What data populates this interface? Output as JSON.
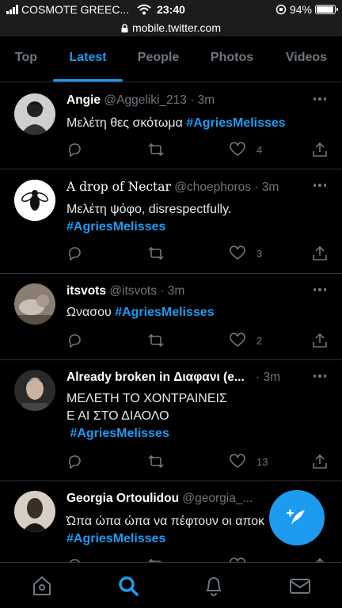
{
  "status_bar": {
    "carrier": "COSMOTE GREEC...",
    "time": "23:40",
    "battery": "94%",
    "battery_level": 0.94
  },
  "url_bar": {
    "url": "mobile.twitter.com"
  },
  "tabs": [
    {
      "label": "Top",
      "active": false
    },
    {
      "label": "Latest",
      "active": true
    },
    {
      "label": "People",
      "active": false
    },
    {
      "label": "Photos",
      "active": false
    },
    {
      "label": "Videos",
      "active": false
    }
  ],
  "tweets": [
    {
      "name": "Angie",
      "handle": "@Aggeliki_213",
      "time": "· 3m",
      "text_plain": "Μελέτη θες σκότωμα ",
      "hashtag": "#AgriesMelisses",
      "likes": "4"
    },
    {
      "name": "A drop of Nectar",
      "handle": "@choephoros",
      "time": "· 3m",
      "text_plain": "Μελέτη ψόφο, disrespectfully.",
      "hashtag": "#AgriesMelisses",
      "likes": "3"
    },
    {
      "name": "itsvots",
      "handle": "@itsvots",
      "time": "· 3m",
      "text_plain": "Ωνασου ",
      "hashtag": "#AgriesMelisses",
      "likes": "2"
    },
    {
      "name": "Already broken in Διαφανι (e...",
      "handle": "",
      "time": "· 3m",
      "text_line1": "ΜΕΛΕΤΗ ΤΟ ΧΟΝΤΡΑΙΝΕΙΣ",
      "text_line2": "Ε ΑΙ ΣΤΟ ΔΙΑΟΛΟ",
      "hashtag": " #AgriesMelisses",
      "likes": "13"
    },
    {
      "name": "Georgia Ortoulidou",
      "handle": "@georgia_...",
      "time": "",
      "text_plain": "Ώπα ώπα ώπα να πέφτουν οι αποκ",
      "hashtag": "#AgriesMelisses",
      "likes": ""
    }
  ],
  "icons": {
    "reply": "reply-icon",
    "retweet": "retweet-icon",
    "like": "heart-icon",
    "share": "share-icon",
    "compose": "compose-tweet-icon",
    "home": "home-icon",
    "search": "search-icon",
    "notifications": "bell-icon",
    "messages": "mail-icon"
  },
  "colors": {
    "accent": "#1d9bf0",
    "background": "#000000",
    "muted": "#6e767d",
    "divider": "#2f3336"
  }
}
